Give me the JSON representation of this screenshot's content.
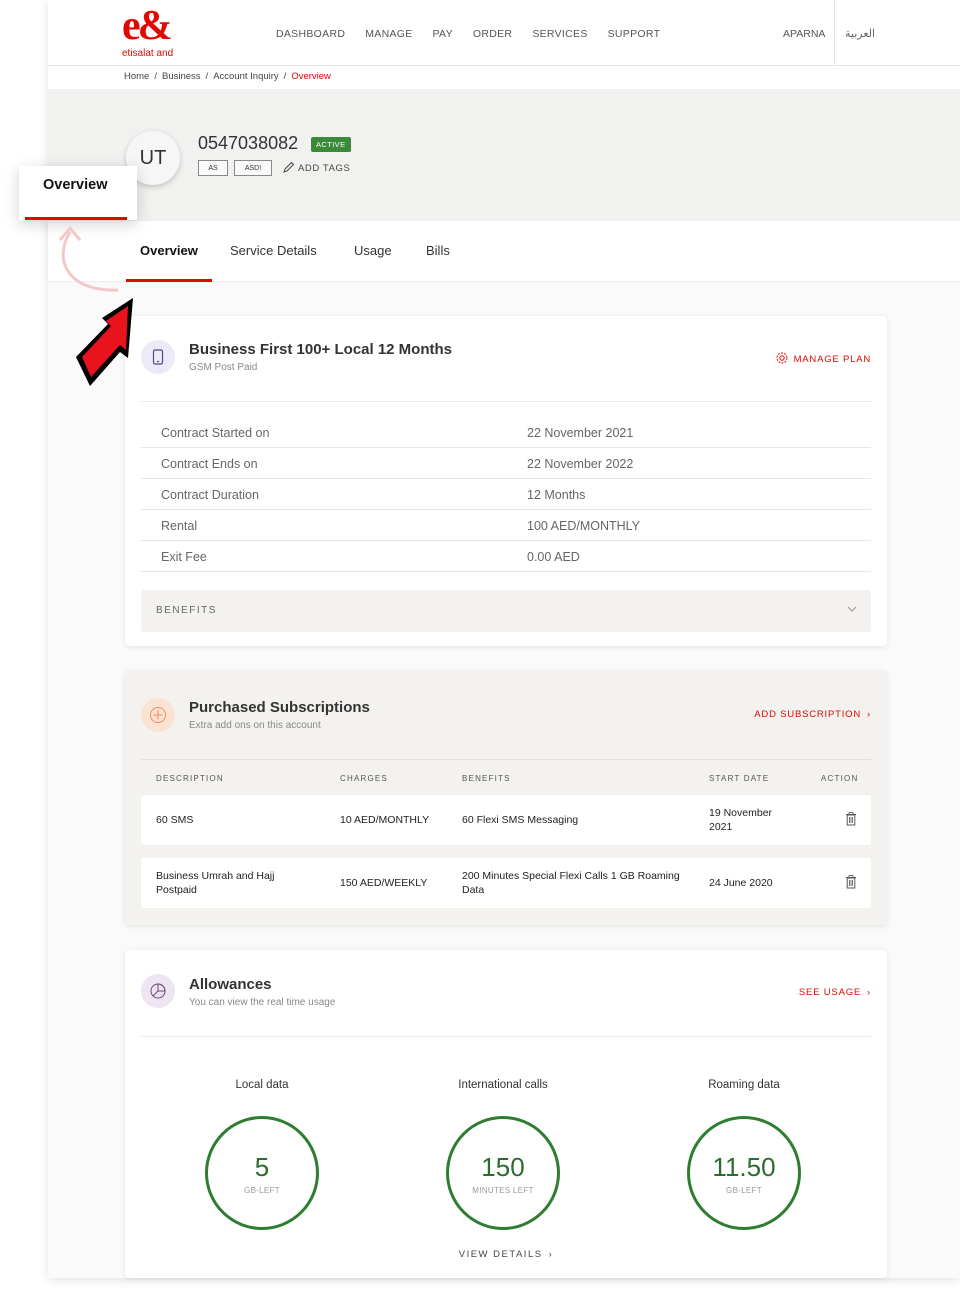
{
  "header": {
    "logo_mark": "e&",
    "logo_text": "etisalat and",
    "nav": [
      "DASHBOARD",
      "MANAGE",
      "PAY",
      "ORDER",
      "SERVICES",
      "SUPPORT"
    ],
    "user": "APARNA",
    "language": "العربية"
  },
  "breadcrumb": [
    "Home",
    "Business",
    "Account Inquiry",
    "Overview"
  ],
  "account": {
    "avatar": "UT",
    "number": "0547038082",
    "status": "ACTIVE",
    "tags": [
      "AS",
      "ASD!"
    ],
    "add_tags": "ADD TAGS"
  },
  "tabs": [
    "Overview",
    "Service Details",
    "Usage",
    "Bills"
  ],
  "callout_label": "Overview",
  "plan": {
    "title": "Business First 100+ Local 12 Months",
    "subtitle": "GSM Post Paid",
    "action": "MANAGE PLAN",
    "rows": [
      {
        "label": "Contract Started on",
        "value": "22 November 2021"
      },
      {
        "label": "Contract Ends on",
        "value": "22 November 2022"
      },
      {
        "label": "Contract Duration",
        "value": "12 Months"
      },
      {
        "label": "Rental",
        "value": "100 AED/MONTHLY"
      },
      {
        "label": "Exit Fee",
        "value": "0.00 AED"
      }
    ],
    "benefits_label": "BENEFITS"
  },
  "subscriptions": {
    "title": "Purchased Subscriptions",
    "subtitle": "Extra add ons on this account",
    "action": "ADD SUBSCRIPTION",
    "columns": [
      "DESCRIPTION",
      "CHARGES",
      "BENEFITS",
      "START DATE",
      "ACTION"
    ],
    "rows": [
      {
        "description": "60 SMS",
        "charges": "10 AED/MONTHLY",
        "benefits": "60 Flexi SMS Messaging",
        "start_date": "19 November 2021"
      },
      {
        "description": "Business Umrah and Hajj Postpaid",
        "charges": "150 AED/WEEKLY",
        "benefits": "200 Minutes Special Flexi Calls 1 GB Roaming Data",
        "start_date": "24 June 2020"
      }
    ]
  },
  "allowances": {
    "title": "Allowances",
    "subtitle": "You can view the real time usage",
    "action": "SEE USAGE",
    "items": [
      {
        "label": "Local data",
        "value": "5",
        "unit": "GB-LEFT"
      },
      {
        "label": "International calls",
        "value": "150",
        "unit": "MINUTES LEFT"
      },
      {
        "label": "Roaming data",
        "value": "11.50",
        "unit": "GB-LEFT"
      }
    ],
    "view_details": "VIEW DETAILS"
  },
  "colors": {
    "accent": "#e00800",
    "success": "#2e7d32",
    "hero_bg": "#f1f1ef"
  }
}
